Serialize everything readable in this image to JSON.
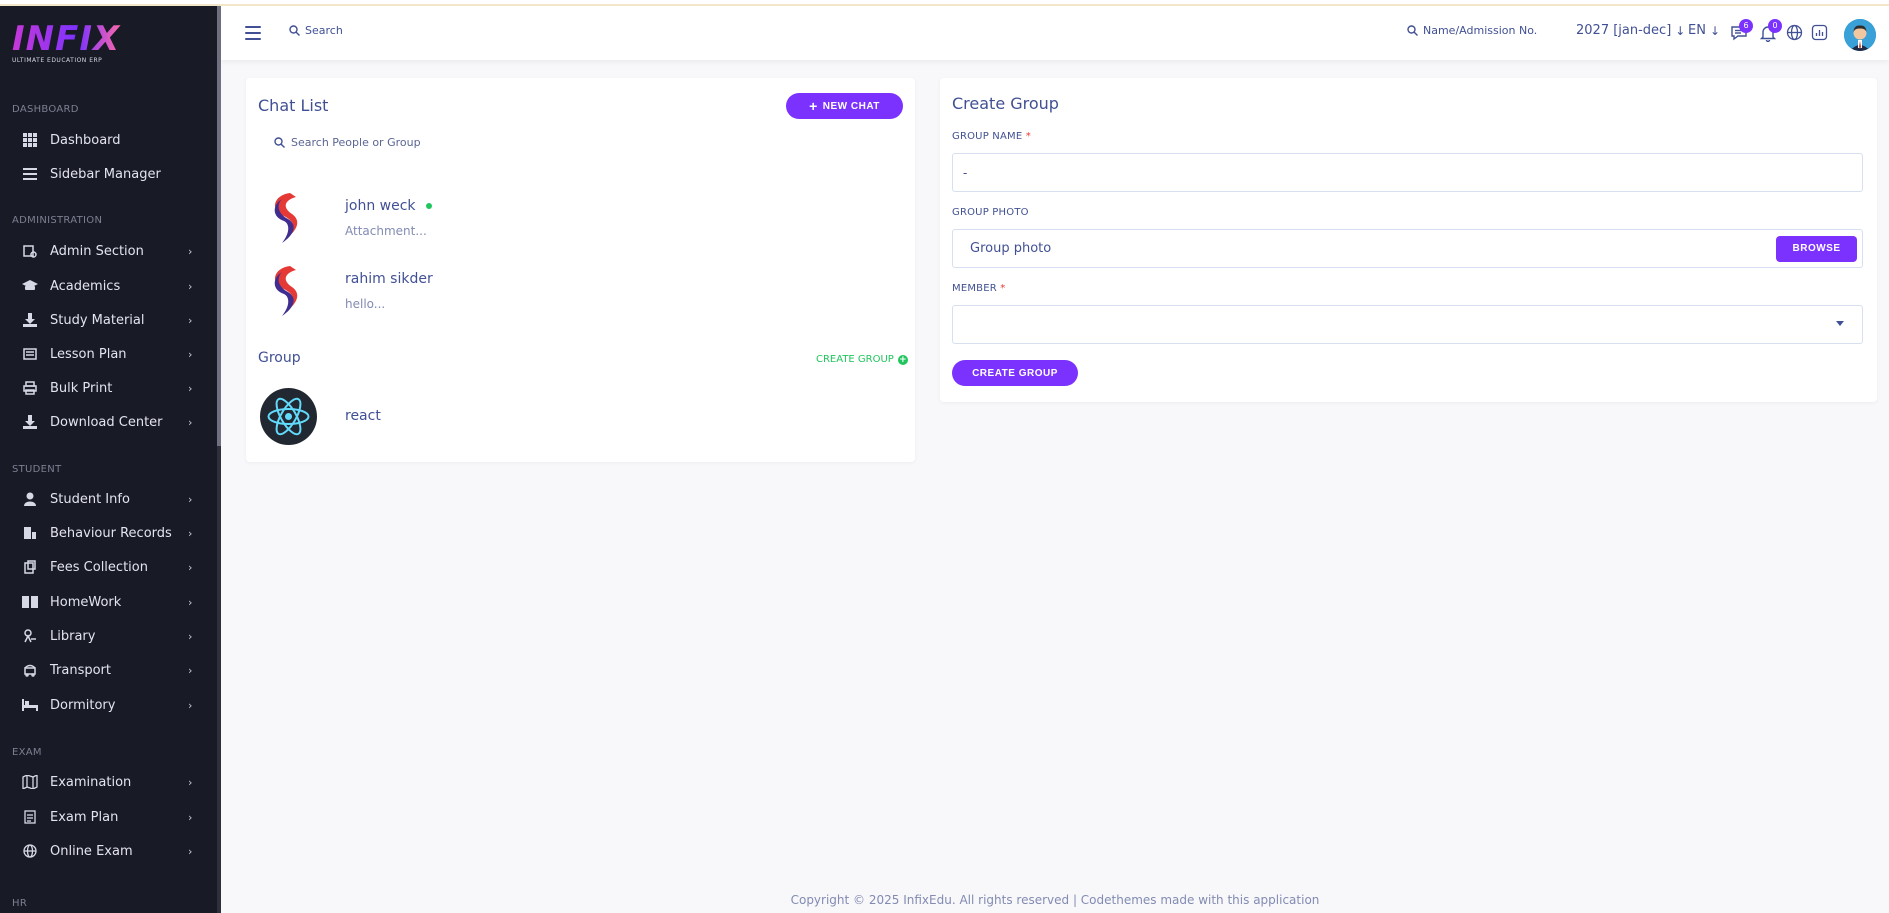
{
  "logo": {
    "text": "INFIX",
    "subtitle": "ULTIMATE EDUCATION ERP"
  },
  "sidebar": {
    "sections": [
      {
        "label": "DASHBOARD",
        "items": [
          {
            "label": "Dashboard",
            "icon": "grid-icon",
            "chevron": false
          },
          {
            "label": "Sidebar Manager",
            "icon": "menu-icon",
            "chevron": false
          }
        ]
      },
      {
        "label": "ADMINISTRATION",
        "items": [
          {
            "label": "Admin Section",
            "icon": "admin-icon",
            "chevron": true
          },
          {
            "label": "Academics",
            "icon": "graduation-cap-icon",
            "chevron": true
          },
          {
            "label": "Study Material",
            "icon": "download-icon",
            "chevron": true
          },
          {
            "label": "Lesson Plan",
            "icon": "lesson-plan-icon",
            "chevron": true
          },
          {
            "label": "Bulk Print",
            "icon": "printer-icon",
            "chevron": true
          },
          {
            "label": "Download Center",
            "icon": "download-icon",
            "chevron": true
          }
        ]
      },
      {
        "label": "STUDENT",
        "items": [
          {
            "label": "Student Info",
            "icon": "user-icon",
            "chevron": true
          },
          {
            "label": "Behaviour Records",
            "icon": "behaviour-icon",
            "chevron": true
          },
          {
            "label": "Fees Collection",
            "icon": "fees-icon",
            "chevron": true
          },
          {
            "label": "HomeWork",
            "icon": "book-icon",
            "chevron": true
          },
          {
            "label": "Library",
            "icon": "library-icon",
            "chevron": true
          },
          {
            "label": "Transport",
            "icon": "bus-icon",
            "chevron": true
          },
          {
            "label": "Dormitory",
            "icon": "bed-icon",
            "chevron": true
          }
        ]
      },
      {
        "label": "EXAM",
        "items": [
          {
            "label": "Examination",
            "icon": "map-icon",
            "chevron": true
          },
          {
            "label": "Exam Plan",
            "icon": "document-icon",
            "chevron": true
          },
          {
            "label": "Online Exam",
            "icon": "globe-icon",
            "chevron": true
          }
        ]
      },
      {
        "label": "HR",
        "items": []
      }
    ]
  },
  "header": {
    "search_label": "Search",
    "student_search_label": "Name/Admission No.",
    "academic_year": "2027 [jan-dec]",
    "language": "EN",
    "messages_badge": "6",
    "notifications_badge": "0"
  },
  "chat_list": {
    "title": "Chat List",
    "new_chat_label": "NEW CHAT",
    "search_placeholder": "Search People or Group",
    "chats": [
      {
        "name": "john weck",
        "message": "Attachment...",
        "online": true
      },
      {
        "name": "rahim sikder",
        "message": "hello...",
        "online": false
      }
    ],
    "group_label": "Group",
    "create_group_link": "CREATE GROUP",
    "groups": [
      {
        "name": "react"
      }
    ]
  },
  "create_group": {
    "title": "Create Group",
    "group_name_label": "GROUP NAME",
    "group_name_value": "-",
    "group_photo_label": "GROUP PHOTO",
    "group_photo_placeholder": "Group photo",
    "browse_label": "BROWSE",
    "member_label": "MEMBER",
    "member_value": "",
    "submit_label": "CREATE GROUP",
    "required_mark": "*"
  },
  "footer": {
    "text": "Copyright © 2025 InfixEdu. All rights reserved | Codethemes made with this application"
  },
  "colors": {
    "primary": "#7c32ff",
    "sidebar_bg": "#181a25",
    "text": "#415094",
    "online": "#21c55d"
  }
}
